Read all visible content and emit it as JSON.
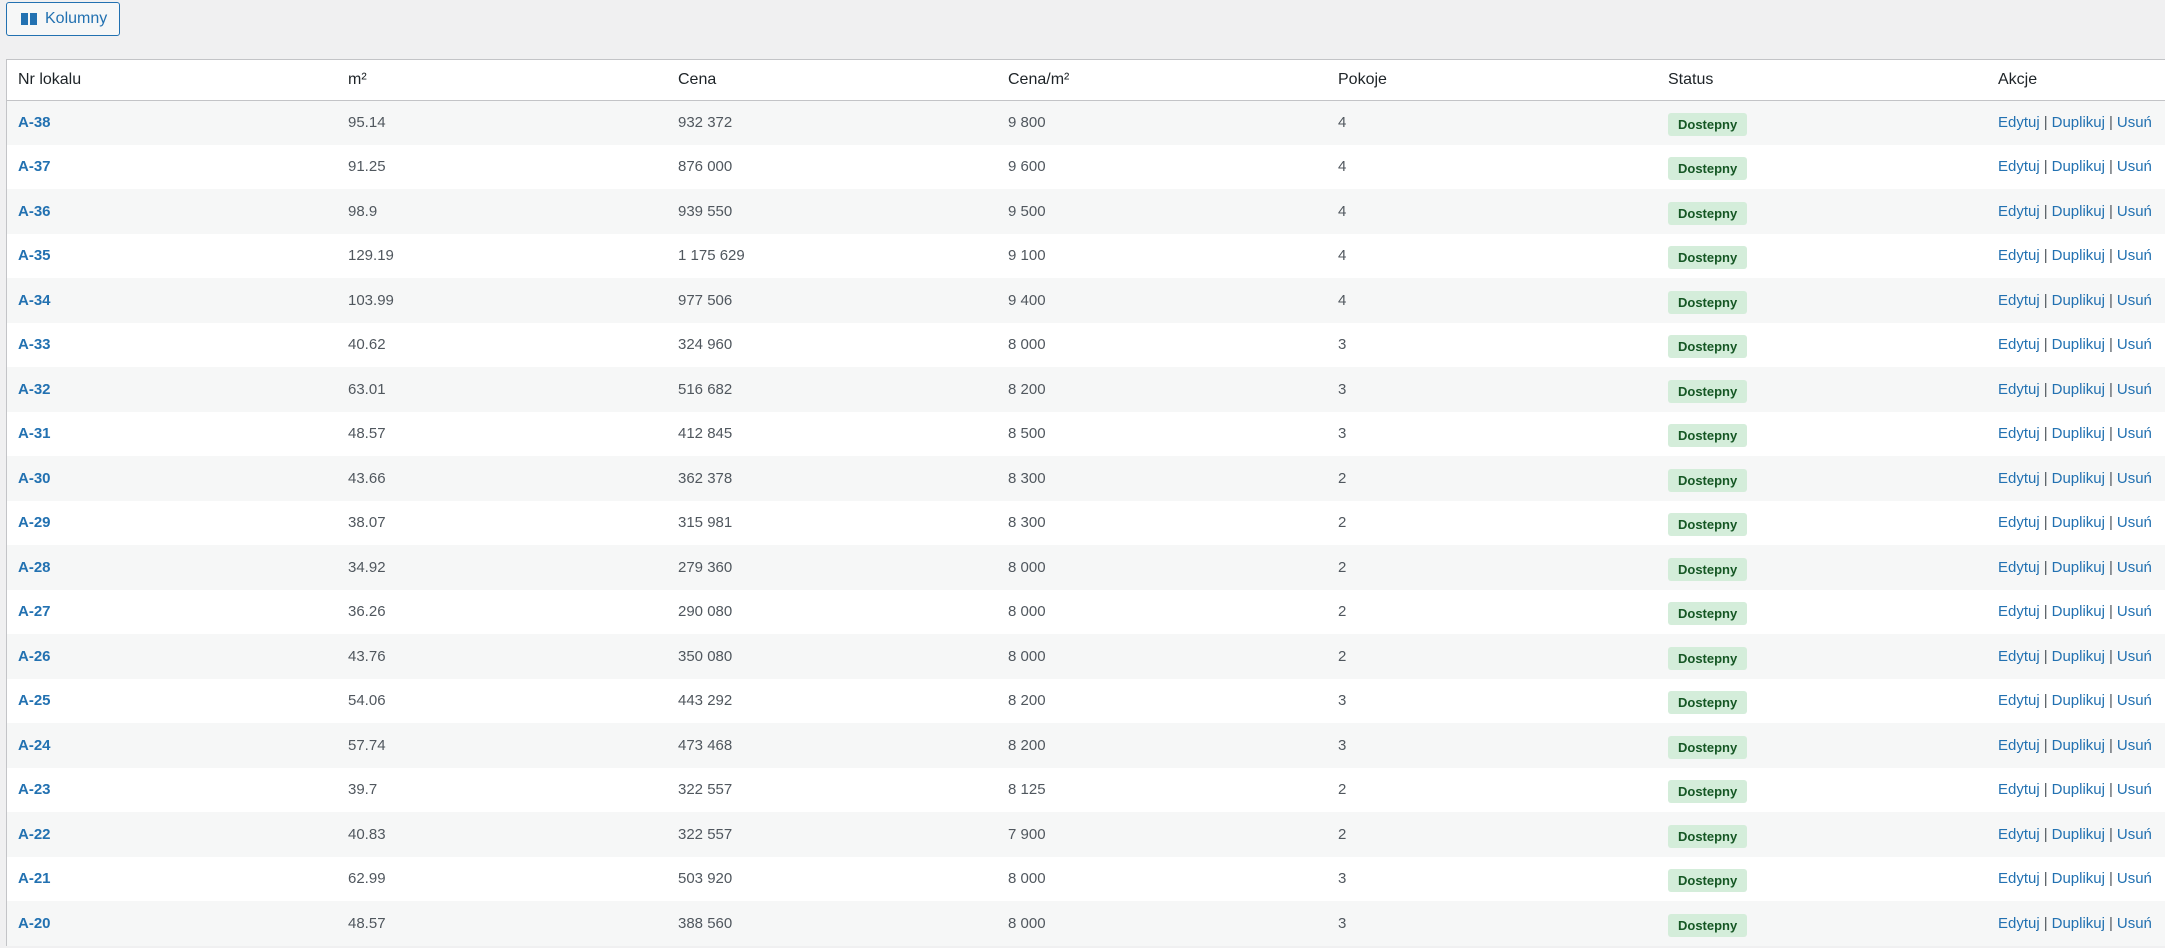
{
  "toolbar": {
    "columns_button": "Kolumny",
    "columns_icon": "columns-icon"
  },
  "table": {
    "headers": [
      "Nr lokalu",
      "m²",
      "Cena",
      "Cena/m²",
      "Pokoje",
      "Status",
      "Akcje"
    ],
    "actions": {
      "edit": "Edytuj",
      "duplicate": "Duplikuj",
      "delete": "Usuń",
      "separator": "|"
    },
    "status_color": "#d4edda",
    "rows": [
      {
        "id": "A-38",
        "area": "95.14",
        "price": "932 372",
        "price_m2": "9 800",
        "rooms": "4",
        "status": "Dostepny"
      },
      {
        "id": "A-37",
        "area": "91.25",
        "price": "876 000",
        "price_m2": "9 600",
        "rooms": "4",
        "status": "Dostepny"
      },
      {
        "id": "A-36",
        "area": "98.9",
        "price": "939 550",
        "price_m2": "9 500",
        "rooms": "4",
        "status": "Dostepny"
      },
      {
        "id": "A-35",
        "area": "129.19",
        "price": "1 175 629",
        "price_m2": "9 100",
        "rooms": "4",
        "status": "Dostepny"
      },
      {
        "id": "A-34",
        "area": "103.99",
        "price": "977 506",
        "price_m2": "9 400",
        "rooms": "4",
        "status": "Dostepny"
      },
      {
        "id": "A-33",
        "area": "40.62",
        "price": "324 960",
        "price_m2": "8 000",
        "rooms": "3",
        "status": "Dostepny"
      },
      {
        "id": "A-32",
        "area": "63.01",
        "price": "516 682",
        "price_m2": "8 200",
        "rooms": "3",
        "status": "Dostepny"
      },
      {
        "id": "A-31",
        "area": "48.57",
        "price": "412 845",
        "price_m2": "8 500",
        "rooms": "3",
        "status": "Dostepny"
      },
      {
        "id": "A-30",
        "area": "43.66",
        "price": "362 378",
        "price_m2": "8 300",
        "rooms": "2",
        "status": "Dostepny"
      },
      {
        "id": "A-29",
        "area": "38.07",
        "price": "315 981",
        "price_m2": "8 300",
        "rooms": "2",
        "status": "Dostepny"
      },
      {
        "id": "A-28",
        "area": "34.92",
        "price": "279 360",
        "price_m2": "8 000",
        "rooms": "2",
        "status": "Dostepny"
      },
      {
        "id": "A-27",
        "area": "36.26",
        "price": "290 080",
        "price_m2": "8 000",
        "rooms": "2",
        "status": "Dostepny"
      },
      {
        "id": "A-26",
        "area": "43.76",
        "price": "350 080",
        "price_m2": "8 000",
        "rooms": "2",
        "status": "Dostepny"
      },
      {
        "id": "A-25",
        "area": "54.06",
        "price": "443 292",
        "price_m2": "8 200",
        "rooms": "3",
        "status": "Dostepny"
      },
      {
        "id": "A-24",
        "area": "57.74",
        "price": "473 468",
        "price_m2": "8 200",
        "rooms": "3",
        "status": "Dostepny"
      },
      {
        "id": "A-23",
        "area": "39.7",
        "price": "322 557",
        "price_m2": "8 125",
        "rooms": "2",
        "status": "Dostepny"
      },
      {
        "id": "A-22",
        "area": "40.83",
        "price": "322 557",
        "price_m2": "7 900",
        "rooms": "2",
        "status": "Dostepny"
      },
      {
        "id": "A-21",
        "area": "62.99",
        "price": "503 920",
        "price_m2": "8 000",
        "rooms": "3",
        "status": "Dostepny"
      },
      {
        "id": "A-20",
        "area": "48.57",
        "price": "388 560",
        "price_m2": "8 000",
        "rooms": "3",
        "status": "Dostepny"
      }
    ]
  }
}
